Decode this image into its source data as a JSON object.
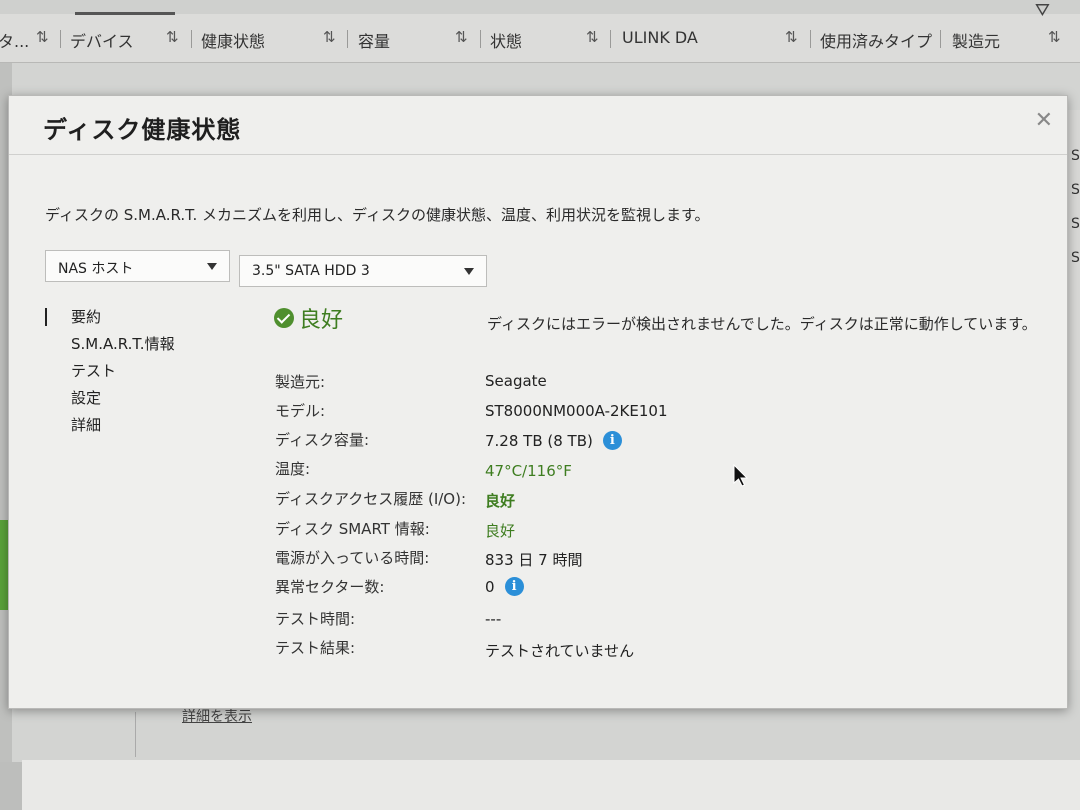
{
  "table_header": {
    "columns": [
      "タ...",
      "デバイス",
      "健康状態",
      "容量",
      "状態",
      "ULINK DA",
      "使用済みタイプ",
      "製造元"
    ]
  },
  "background": {
    "link_text": "詳細を表示",
    "right_letters": [
      "S",
      "S",
      "S",
      "S"
    ]
  },
  "dialog": {
    "title": "ディスク健康状態",
    "description": "ディスクの S.M.A.R.T. メカニズムを利用し、ディスクの健康状態、温度、利用状況を監視します。",
    "host_select": "NAS ホスト",
    "disk_select": "3.5\" SATA HDD 3",
    "nav": [
      "要約",
      "S.M.A.R.T.情報",
      "テスト",
      "設定",
      "詳細"
    ],
    "status": "良好",
    "message": "ディスクにはエラーが検出されませんでした。ディスクは正常に動作しています。",
    "rows": [
      {
        "label": "製造元:",
        "value": "Seagate"
      },
      {
        "label": "モデル:",
        "value": "ST8000NM000A-2KE101"
      },
      {
        "label": "ディスク容量:",
        "value": "7.28 TB (8 TB)"
      },
      {
        "label": "温度:",
        "value": "47°C/116°F"
      },
      {
        "label": "ディスクアクセス履歴 (I/O):",
        "value": "良好"
      },
      {
        "label": "ディスク SMART 情報:",
        "value": "良好"
      },
      {
        "label": "電源が入っている時間:",
        "value": "833 日 7 時間"
      },
      {
        "label": "異常セクター数:",
        "value": "0"
      },
      {
        "label": "テスト時間:",
        "value": "---"
      },
      {
        "label": "テスト結果:",
        "value": "テストされていません"
      }
    ]
  },
  "colors": {
    "good_green": "#3e7d20",
    "info_blue": "#2b8fd8"
  }
}
